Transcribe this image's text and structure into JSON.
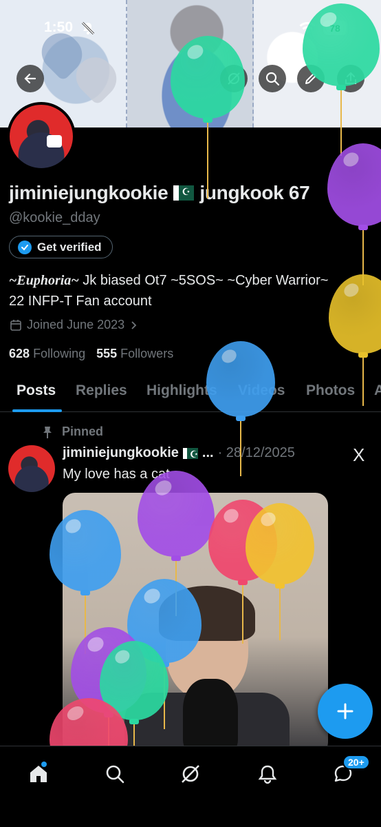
{
  "status_bar": {
    "time": "1:50",
    "battery": "78"
  },
  "profile": {
    "display_name": "jiminiejungkookie",
    "name_suffix": "jungkook 67",
    "handle": "@kookie_dday",
    "verify_button": "Get verified",
    "bio_italic": "~Euphoria~",
    "bio_rest": " Jk biased Ot7 ~5SOS~ ~Cyber Warrior~ 22 INFP-T Fan account",
    "joined": "Joined June 2023",
    "following_count": "628",
    "following_label": "Following",
    "followers_count": "555",
    "followers_label": "Followers"
  },
  "tabs": [
    {
      "label": "Posts",
      "active": true
    },
    {
      "label": "Replies"
    },
    {
      "label": "Highlights"
    },
    {
      "label": "Videos"
    },
    {
      "label": "Photos"
    },
    {
      "label": "A"
    }
  ],
  "post": {
    "pinned_label": "Pinned",
    "author": "jiminiejungkookie",
    "ellipsis": "...",
    "date": "· 28/12/2025",
    "x_logo": "X",
    "text": "My love has a cat"
  },
  "bottom_nav": {
    "messages_badge": "20+"
  },
  "icons": [
    "back-arrow-icon",
    "grok-icon",
    "search-icon",
    "pencil-icon",
    "share-icon",
    "verified-badge-icon",
    "calendar-icon",
    "chevron-right-icon",
    "pin-icon",
    "plus-icon",
    "home-icon",
    "explore-icon",
    "grok-nav-icon",
    "notifications-icon",
    "messages-icon"
  ],
  "colors": {
    "accent": "#1d9bf0",
    "background": "#000000",
    "text_primary": "#e7e9ea",
    "text_secondary": "#71767b"
  }
}
